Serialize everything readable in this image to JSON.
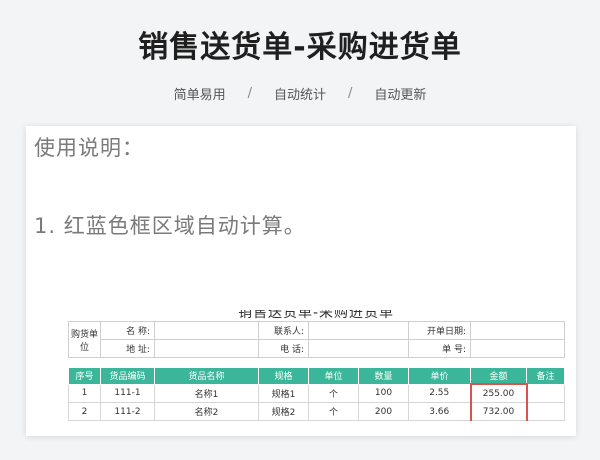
{
  "page_title": "销售送货单-采购进货单",
  "tags": [
    "简单易用",
    "自动统计",
    "自动更新"
  ],
  "tag_separator": "/",
  "usage": {
    "title": "使用说明：",
    "note": "1. 红蓝色框区域自动计算。"
  },
  "doc": {
    "title": "销售送货单-采购进货单",
    "party_label": "购货单位",
    "name_label": "名 称:",
    "address_label": "地 址:",
    "contact_label": "联系人:",
    "phone_label": "电 话:",
    "date_label": "开单日期:",
    "number_label": "单 号:",
    "headers": [
      "序号",
      "货品编码",
      "货品名称",
      "规格",
      "单位",
      "数量",
      "单价",
      "金额",
      "备注"
    ],
    "rows": [
      [
        "1",
        "111-1",
        "名称1",
        "规格1",
        "个",
        "100",
        "2.55",
        "255.00",
        ""
      ],
      [
        "2",
        "111-2",
        "名称2",
        "规格2",
        "个",
        "200",
        "3.66",
        "732.00",
        ""
      ]
    ],
    "header_color": "#3bb69a",
    "amount_border_color": "#d9534f"
  }
}
